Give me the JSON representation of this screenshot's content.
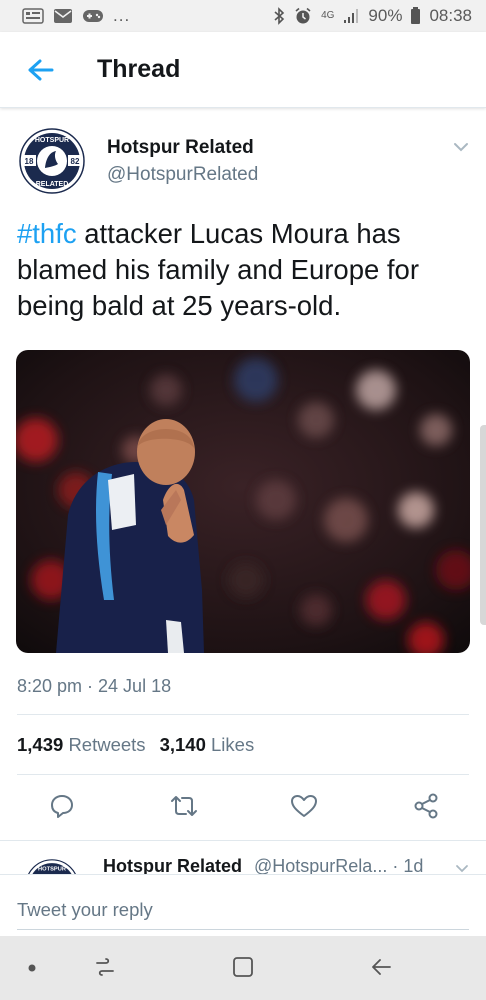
{
  "status_bar": {
    "network": "4G",
    "battery": "90%",
    "time": "08:38",
    "more": "..."
  },
  "header": {
    "title": "Thread"
  },
  "tweet": {
    "author_name": "Hotspur Related",
    "author_handle": "@HotspurRelated",
    "avatar_text_top": "HOTSPUR",
    "avatar_text_bottom": "RELATED",
    "avatar_year_left": "18",
    "avatar_year_right": "82",
    "hashtag": "#thfc",
    "text": " attacker Lucas Moura has blamed his family and Europe for being bald at 25 years-old.",
    "timestamp": "8:20 pm · 24 Jul 18",
    "retweets_count": "1,439",
    "retweets_label": "Retweets",
    "likes_count": "3,140",
    "likes_label": "Likes"
  },
  "reply_peek": {
    "name": "Hotspur Related",
    "meta": "@HotspurRela... · 1d"
  },
  "reply_bar": {
    "placeholder": "Tweet your reply"
  },
  "colors": {
    "accent": "#1da1f2",
    "muted": "#657786",
    "text": "#14171a",
    "avatar_navy": "#1b2a4e"
  }
}
